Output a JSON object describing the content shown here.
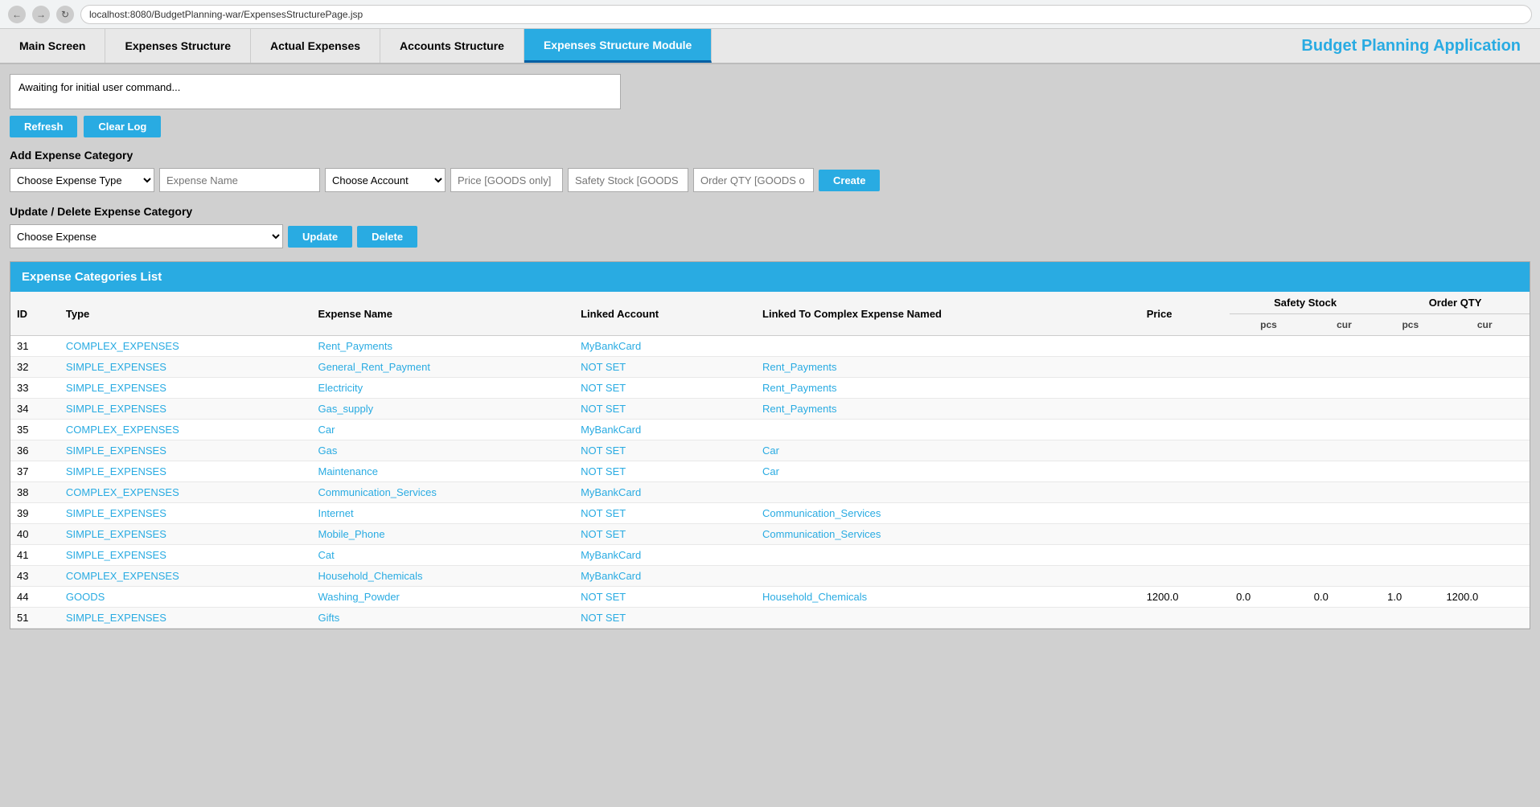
{
  "browser": {
    "url": "localhost:8080/BudgetPlanning-war/ExpensesStructurePage.jsp"
  },
  "nav": {
    "items": [
      {
        "label": "Main Screen",
        "id": "main-screen",
        "active": false
      },
      {
        "label": "Expenses Structure",
        "id": "expenses-structure",
        "active": false
      },
      {
        "label": "Actual Expenses",
        "id": "actual-expenses",
        "active": false
      },
      {
        "label": "Accounts Structure",
        "id": "accounts-structure",
        "active": false
      },
      {
        "label": "Expenses Structure Module",
        "id": "expenses-structure-module",
        "active": true
      }
    ],
    "app_title": "Budget Planning Application"
  },
  "log": {
    "text": "Awaiting for initial user command..."
  },
  "buttons": {
    "refresh": "Refresh",
    "clear_log": "Clear Log"
  },
  "add_section": {
    "title": "Add Expense Category",
    "expense_type_placeholder": "Choose Expense Type",
    "expense_name_placeholder": "Expense Name",
    "choose_account_placeholder": "Choose Account",
    "price_placeholder": "Price [GOODS only]",
    "safety_placeholder": "Safety Stock [GOODS",
    "order_placeholder": "Order QTY [GOODS o",
    "create_btn": "Create"
  },
  "update_section": {
    "title": "Update / Delete Expense Category",
    "choose_expense_placeholder": "Choose Expense",
    "update_btn": "Update",
    "delete_btn": "Delete"
  },
  "table": {
    "title": "Expense Categories List",
    "columns": {
      "id": "ID",
      "type": "Type",
      "expense_name": "Expense Name",
      "linked_account": "Linked Account",
      "linked_to": "Linked To Complex Expense Named",
      "price": "Price",
      "safety_stock": "Safety Stock",
      "order_qty": "Order QTY",
      "pcs": "pcs",
      "cur": "cur"
    },
    "rows": [
      {
        "id": "31",
        "type": "COMPLEX_EXPENSES",
        "expense_name": "Rent_Payments",
        "linked_account": "MyBankCard",
        "linked_to": "",
        "price": "",
        "ss_pcs": "",
        "ss_cur": "",
        "oq_pcs": "",
        "oq_cur": ""
      },
      {
        "id": "32",
        "type": "SIMPLE_EXPENSES",
        "expense_name": "General_Rent_Payment",
        "linked_account": "NOT SET",
        "linked_to": "Rent_Payments",
        "price": "",
        "ss_pcs": "",
        "ss_cur": "",
        "oq_pcs": "",
        "oq_cur": ""
      },
      {
        "id": "33",
        "type": "SIMPLE_EXPENSES",
        "expense_name": "Electricity",
        "linked_account": "NOT SET",
        "linked_to": "Rent_Payments",
        "price": "",
        "ss_pcs": "",
        "ss_cur": "",
        "oq_pcs": "",
        "oq_cur": ""
      },
      {
        "id": "34",
        "type": "SIMPLE_EXPENSES",
        "expense_name": "Gas_supply",
        "linked_account": "NOT SET",
        "linked_to": "Rent_Payments",
        "price": "",
        "ss_pcs": "",
        "ss_cur": "",
        "oq_pcs": "",
        "oq_cur": ""
      },
      {
        "id": "35",
        "type": "COMPLEX_EXPENSES",
        "expense_name": "Car",
        "linked_account": "MyBankCard",
        "linked_to": "",
        "price": "",
        "ss_pcs": "",
        "ss_cur": "",
        "oq_pcs": "",
        "oq_cur": ""
      },
      {
        "id": "36",
        "type": "SIMPLE_EXPENSES",
        "expense_name": "Gas",
        "linked_account": "NOT SET",
        "linked_to": "Car",
        "price": "",
        "ss_pcs": "",
        "ss_cur": "",
        "oq_pcs": "",
        "oq_cur": ""
      },
      {
        "id": "37",
        "type": "SIMPLE_EXPENSES",
        "expense_name": "Maintenance",
        "linked_account": "NOT SET",
        "linked_to": "Car",
        "price": "",
        "ss_pcs": "",
        "ss_cur": "",
        "oq_pcs": "",
        "oq_cur": ""
      },
      {
        "id": "38",
        "type": "COMPLEX_EXPENSES",
        "expense_name": "Communication_Services",
        "linked_account": "MyBankCard",
        "linked_to": "",
        "price": "",
        "ss_pcs": "",
        "ss_cur": "",
        "oq_pcs": "",
        "oq_cur": ""
      },
      {
        "id": "39",
        "type": "SIMPLE_EXPENSES",
        "expense_name": "Internet",
        "linked_account": "NOT SET",
        "linked_to": "Communication_Services",
        "price": "",
        "ss_pcs": "",
        "ss_cur": "",
        "oq_pcs": "",
        "oq_cur": ""
      },
      {
        "id": "40",
        "type": "SIMPLE_EXPENSES",
        "expense_name": "Mobile_Phone",
        "linked_account": "NOT SET",
        "linked_to": "Communication_Services",
        "price": "",
        "ss_pcs": "",
        "ss_cur": "",
        "oq_pcs": "",
        "oq_cur": ""
      },
      {
        "id": "41",
        "type": "SIMPLE_EXPENSES",
        "expense_name": "Cat",
        "linked_account": "MyBankCard",
        "linked_to": "",
        "price": "",
        "ss_pcs": "",
        "ss_cur": "",
        "oq_pcs": "",
        "oq_cur": ""
      },
      {
        "id": "43",
        "type": "COMPLEX_EXPENSES",
        "expense_name": "Household_Chemicals",
        "linked_account": "MyBankCard",
        "linked_to": "",
        "price": "",
        "ss_pcs": "",
        "ss_cur": "",
        "oq_pcs": "",
        "oq_cur": ""
      },
      {
        "id": "44",
        "type": "GOODS",
        "expense_name": "Washing_Powder",
        "linked_account": "NOT SET",
        "linked_to": "Household_Chemicals",
        "price": "1200.0",
        "ss_pcs": "0.0",
        "ss_cur": "0.0",
        "oq_pcs": "1.0",
        "oq_cur": "1200.0"
      },
      {
        "id": "51",
        "type": "SIMPLE_EXPENSES",
        "expense_name": "Gifts",
        "linked_account": "NOT SET",
        "linked_to": "",
        "price": "",
        "ss_pcs": "",
        "ss_cur": "",
        "oq_pcs": "",
        "oq_cur": ""
      }
    ]
  }
}
